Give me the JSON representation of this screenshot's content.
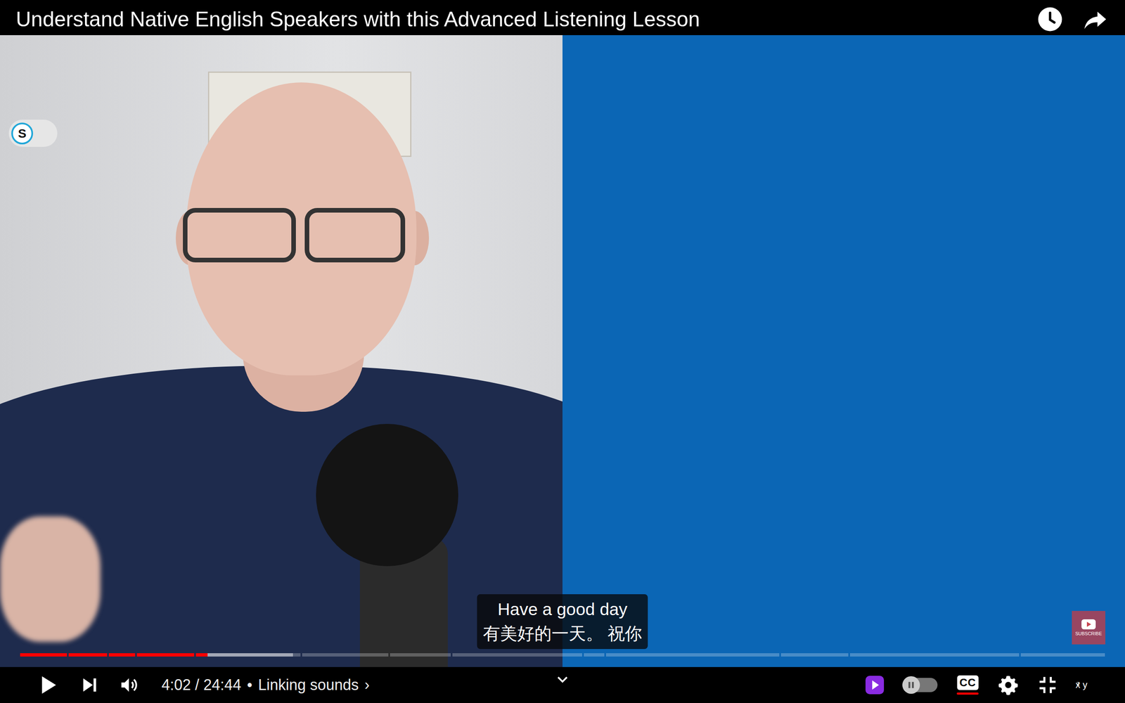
{
  "window": {
    "title": "Understand Native English Speakers with this Advanced Listening Lesson"
  },
  "extension_toggle": {
    "label": "S",
    "on": false
  },
  "captions": {
    "on": true,
    "lines": [
      "Have a good day",
      "有美好的一天。 祝你"
    ]
  },
  "watermark": {
    "label": "SUBSCRIBE"
  },
  "progress": {
    "level": 0.17,
    "buffered": 0.25,
    "chapters": [
      0.044,
      0.036,
      0.025,
      0.054,
      0.098,
      0.081,
      0.057,
      0.122,
      0.019,
      0.163,
      0.063,
      0.159,
      0.079
    ]
  },
  "controls": {
    "playing": false,
    "time": "4:02 / 24:44",
    "separator": "•",
    "chapter": "Linking sounds",
    "chapter_arrow": "›"
  },
  "autoplay": {
    "on": false
  },
  "cc_label": "CC",
  "miniplayer": {
    "sup": "z",
    "label": "x y"
  }
}
